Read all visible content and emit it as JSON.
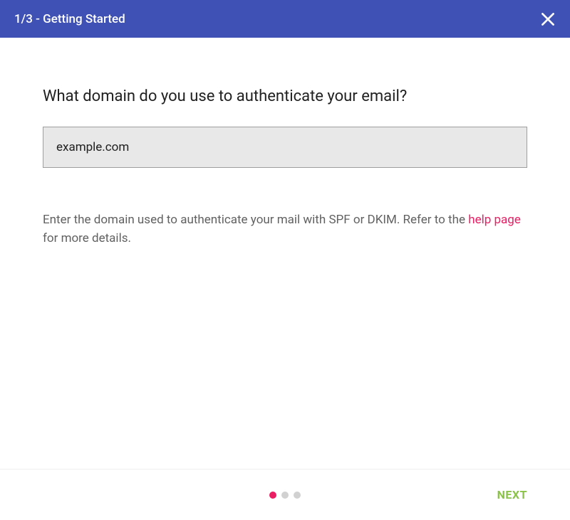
{
  "header": {
    "title": "1/3 - Getting Started"
  },
  "main": {
    "question": "What domain do you use to authenticate your email?",
    "domain_input_value": "example.com",
    "help_text_before": "Enter the domain used to authenticate your mail with SPF or DKIM. Refer to the ",
    "help_link_text": "help page",
    "help_text_after": " for more details."
  },
  "footer": {
    "next_label": "NEXT",
    "step_count": 3,
    "active_step": 1
  }
}
